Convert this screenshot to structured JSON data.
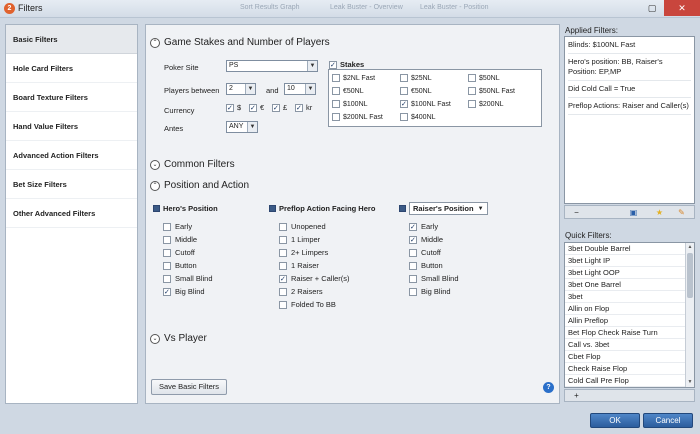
{
  "window": {
    "title": "Filters",
    "ghost_tabs": [
      "Sort Results Graph",
      "Leak Buster - Overview",
      "Leak Buster - Position"
    ]
  },
  "sidebar": {
    "items": [
      {
        "label": "Basic Filters",
        "active": true
      },
      {
        "label": "Hole Card Filters"
      },
      {
        "label": "Board Texture Filters"
      },
      {
        "label": "Hand Value Filters"
      },
      {
        "label": "Advanced Action Filters"
      },
      {
        "label": "Bet Size Filters"
      },
      {
        "label": "Other Advanced Filters"
      }
    ]
  },
  "game_stakes": {
    "heading": "Game Stakes and Number of Players",
    "poker_site_label": "Poker Site",
    "poker_site_value": "PS",
    "players_between_label": "Players between",
    "players_min": "2",
    "and_label": "and",
    "players_max": "10",
    "currency_label": "Currency",
    "currencies": [
      "$",
      "€",
      "£",
      "kr"
    ],
    "antes_label": "Antes",
    "antes_value": "ANY",
    "stakes_label": "Stakes",
    "stakes": [
      {
        "label": "$2NL Fast",
        "checked": false
      },
      {
        "label": "$25NL",
        "checked": false
      },
      {
        "label": "$50NL",
        "checked": false
      },
      {
        "label": "€50NL",
        "checked": false
      },
      {
        "label": "€50NL",
        "checked": false
      },
      {
        "label": "$50NL Fast",
        "checked": false
      },
      {
        "label": "$100NL",
        "checked": false
      },
      {
        "label": "$100NL Fast",
        "checked": true
      },
      {
        "label": "$200NL",
        "checked": false
      },
      {
        "label": "$200NL Fast",
        "checked": false
      },
      {
        "label": "$400NL",
        "checked": false
      }
    ]
  },
  "common_filters": {
    "heading": "Common Filters"
  },
  "position_action": {
    "heading": "Position and Action",
    "heros_position": {
      "label": "Hero's Position",
      "items": [
        {
          "label": "Early",
          "checked": false
        },
        {
          "label": "Middle",
          "checked": false
        },
        {
          "label": "Cutoff",
          "checked": false
        },
        {
          "label": "Button",
          "checked": false
        },
        {
          "label": "Small Blind",
          "checked": false
        },
        {
          "label": "Big Blind",
          "checked": true
        }
      ]
    },
    "preflop_action": {
      "label": "Preflop Action Facing Hero",
      "items": [
        {
          "label": "Unopened",
          "checked": false
        },
        {
          "label": "1 Limper",
          "checked": false
        },
        {
          "label": "2+ Limpers",
          "checked": false
        },
        {
          "label": "1 Raiser",
          "checked": false
        },
        {
          "label": "Raiser + Caller(s)",
          "checked": true
        },
        {
          "label": "2 Raisers",
          "checked": false
        },
        {
          "label": "Folded To BB",
          "checked": false
        }
      ]
    },
    "raisers_position": {
      "label": "Raiser's Position",
      "items": [
        {
          "label": "Early",
          "checked": true
        },
        {
          "label": "Middle",
          "checked": true
        },
        {
          "label": "Cutoff",
          "checked": false
        },
        {
          "label": "Button",
          "checked": false
        },
        {
          "label": "Small Blind",
          "checked": false
        },
        {
          "label": "Big Blind",
          "checked": false
        }
      ]
    }
  },
  "vs_player": {
    "heading": "Vs Player"
  },
  "save_basic_label": "Save Basic Filters",
  "help_label": "?",
  "applied_filters": {
    "title": "Applied Filters:",
    "items": [
      "Blinds: $100NL Fast",
      "Hero's position: BB, Raiser's Position: EP,MP",
      "Did Cold Call = True",
      "Preflop Actions: Raiser and Caller(s)"
    ]
  },
  "quick_filters": {
    "title": "Quick Filters:",
    "items": [
      "3bet Double Barrel",
      "3bet Light IP",
      "3bet Light OOP",
      "3bet One Barrel",
      "3bet",
      "Allin on Flop",
      "Allin Preflop",
      "Bet Flop Check Raise Turn",
      "Call vs. 3bet",
      "Cbet Flop",
      "Check Raise Flop",
      "Cold Call Pre Flop"
    ],
    "add_label": "+"
  },
  "buttons": {
    "ok": "OK",
    "cancel": "Cancel"
  },
  "colors": {
    "accent": "#2c5d9d",
    "close": "#c9463d"
  }
}
